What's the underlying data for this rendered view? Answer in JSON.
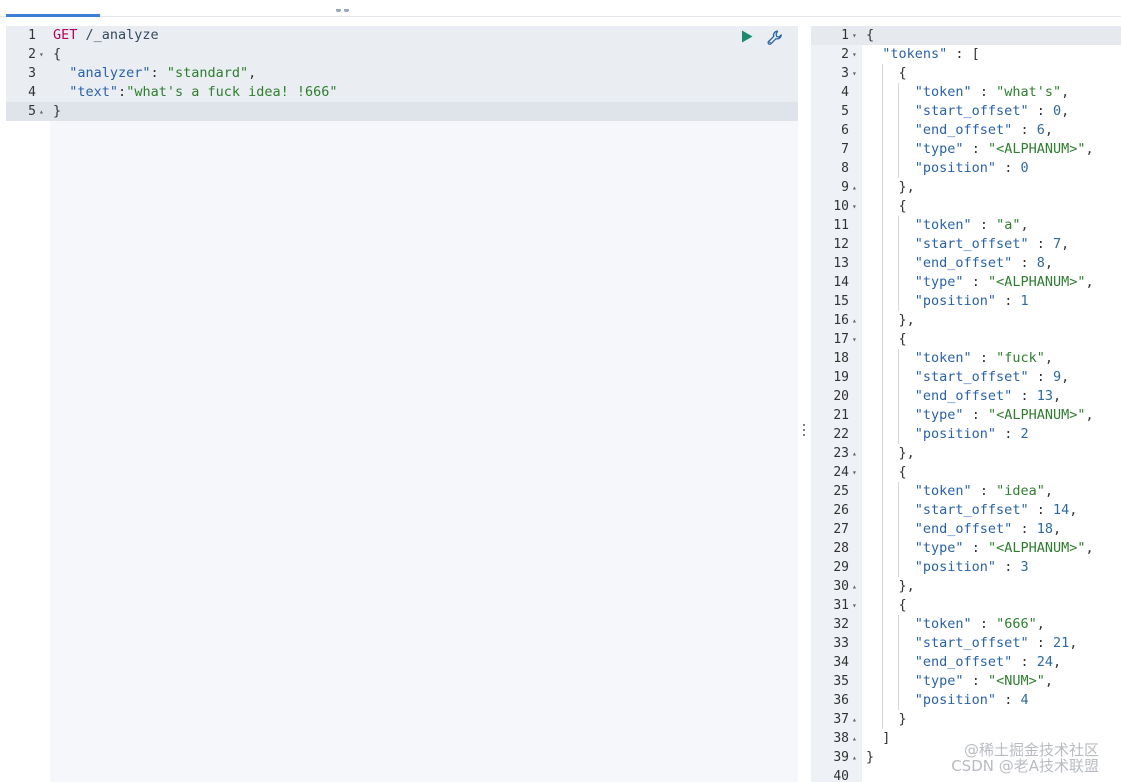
{
  "request": {
    "method": "GET",
    "path": "/_analyze",
    "lines": [
      {
        "n": "1",
        "fold": ""
      },
      {
        "n": "2",
        "fold": "▾"
      },
      {
        "n": "3",
        "fold": ""
      },
      {
        "n": "4",
        "fold": ""
      },
      {
        "n": "5",
        "fold": "▴"
      }
    ],
    "open_brace": "{",
    "close_brace": "}",
    "body": {
      "analyzer_key": "\"analyzer\"",
      "analyzer_value": "\"standard\"",
      "text_key": "\"text\"",
      "text_value": "\"what's a fuck idea! !666\""
    }
  },
  "response": {
    "line_count": 40,
    "fold_markers": {
      "1": "▾",
      "2": "▾",
      "3": "▾",
      "9": "▴",
      "10": "▾",
      "16": "▴",
      "17": "▾",
      "23": "▴",
      "24": "▾",
      "30": "▴",
      "31": "▾",
      "37": "▴",
      "38": "▴",
      "39": "▴"
    },
    "tokens_key": "\"tokens\"",
    "items": [
      {
        "token": "\"what's\"",
        "start_offset": "0",
        "end_offset": "6",
        "type": "\"<ALPHANUM>\"",
        "position": "0"
      },
      {
        "token": "\"a\"",
        "start_offset": "7",
        "end_offset": "8",
        "type": "\"<ALPHANUM>\"",
        "position": "1"
      },
      {
        "token": "\"fuck\"",
        "start_offset": "9",
        "end_offset": "13",
        "type": "\"<ALPHANUM>\"",
        "position": "2"
      },
      {
        "token": "\"idea\"",
        "start_offset": "14",
        "end_offset": "18",
        "type": "\"<ALPHANUM>\"",
        "position": "3"
      },
      {
        "token": "\"666\"",
        "start_offset": "21",
        "end_offset": "24",
        "type": "\"<NUM>\"",
        "position": "4"
      }
    ],
    "field_keys": {
      "token": "\"token\"",
      "start_offset": "\"start_offset\"",
      "end_offset": "\"end_offset\"",
      "type": "\"type\"",
      "position": "\"position\""
    }
  },
  "toolbar": {
    "run_icon": "play-icon",
    "settings_icon": "wrench-icon"
  },
  "watermark": {
    "line1": "@稀土掘金技术社区",
    "line2": "CSDN @老A技术联盟"
  },
  "colors": {
    "method": "#b8005f",
    "key": "#2a62a8",
    "string": "#2f7d2f",
    "number": "#2d6a9f",
    "run_button": "#1b8a6e"
  }
}
